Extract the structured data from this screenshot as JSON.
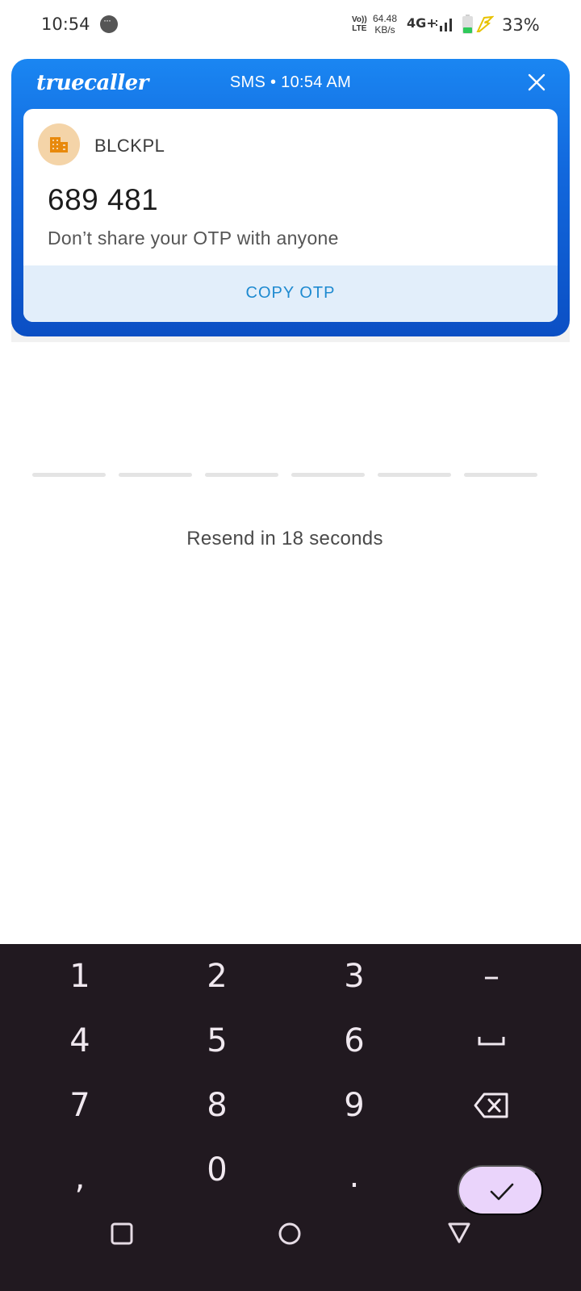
{
  "status_bar": {
    "time": "10:54",
    "volte_line1": "Vo))",
    "volte_line2": "LTE",
    "speed_value": "64.48",
    "speed_unit": "KB/s",
    "network": "4G+",
    "battery_percent": "33%",
    "battery_level": 0.33,
    "icons": [
      "message-notification-icon",
      "signal-icon",
      "battery-icon",
      "charging-icon"
    ]
  },
  "truecaller": {
    "logo": "truecaller",
    "meta": "SMS • 10:54 AM",
    "sender": "BLCKPL",
    "otp": "689 481",
    "message": "Don’t share your OTP with anyone",
    "copy_button": "COPY OTP",
    "colors": {
      "header_top": "#1a86f2",
      "header_bottom": "#0b4fc4",
      "copy_bg": "#e2eefa",
      "copy_text": "#1e8ad0",
      "avatar_bg": "#f4d4a8",
      "avatar_icon": "#e8890c"
    }
  },
  "otp_input": {
    "box_count": 6
  },
  "resend_text": "Resend in 18 seconds",
  "keyboard": {
    "rows": [
      [
        "1",
        "2",
        "3",
        "–"
      ],
      [
        "4",
        "5",
        "6",
        "space-icon"
      ],
      [
        "7",
        "8",
        "9",
        "backspace-icon"
      ],
      [
        ",",
        "0",
        ".",
        "check-icon"
      ]
    ],
    "colors": {
      "background": "#211920",
      "key_text": "#f0e8ef",
      "enter_bg": "#ead4fb"
    }
  },
  "nav_bar": {
    "icons": [
      "recent-apps-icon",
      "home-icon",
      "back-icon"
    ]
  }
}
